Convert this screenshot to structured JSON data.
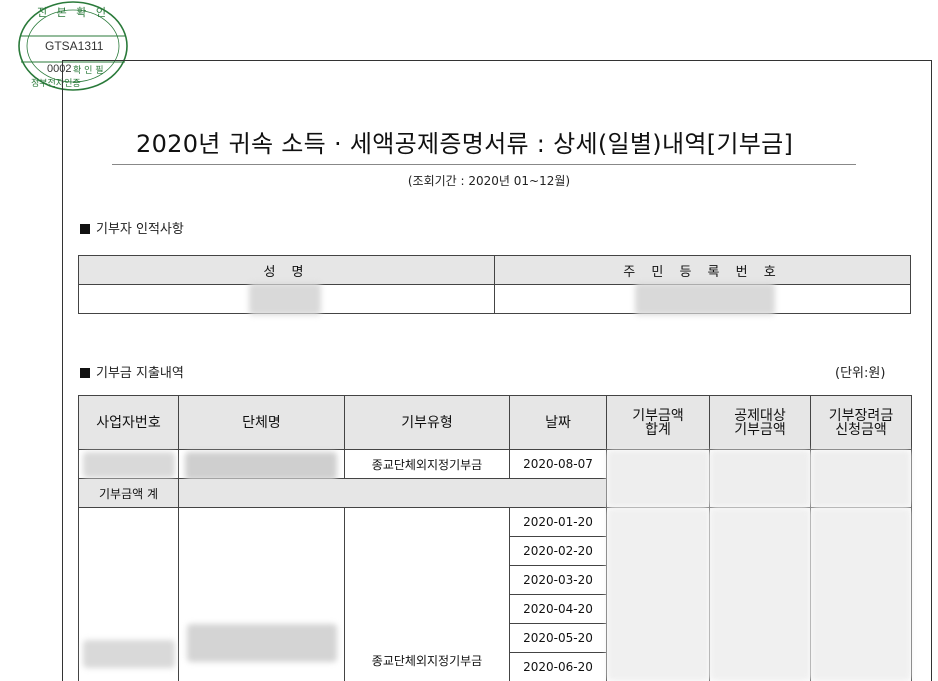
{
  "stamp": {
    "top_text": "진 본 확 인",
    "code1": "GTSA1311",
    "code2": "0002",
    "bottom_text": "정부전자인증",
    "side_text": "확 인 필"
  },
  "document": {
    "title": "2020년 귀속 소득 · 세액공제증명서류 : 상세(일별)내역[기부금]",
    "period": "(조회기간 : 2020년 01~12월)"
  },
  "donor_section": {
    "heading": "기부자 인적사항",
    "headers": [
      "성 명",
      "주 민 등 록 번 호"
    ]
  },
  "donation_section": {
    "heading": "기부금 지출내역",
    "unit": "(단위:원)",
    "headers": {
      "biz_no": "사업자번호",
      "org_name": "단체명",
      "type": "기부유형",
      "date": "날짜",
      "total": [
        "기부금액",
        "합계"
      ],
      "deductible": [
        "공제대상",
        "기부금액"
      ],
      "incentive": [
        "기부장려금",
        "신청금액"
      ]
    },
    "row1": {
      "type": "종교단체외지정기부금",
      "date": "2020-08-07"
    },
    "subtotal_label": "기부금액 계",
    "group2": {
      "type": "종교단체외지정기부금",
      "dates": [
        "2020-01-20",
        "2020-02-20",
        "2020-03-20",
        "2020-04-20",
        "2020-05-20",
        "2020-06-20"
      ]
    }
  },
  "colors": {
    "header_bg": "#e6e6e6",
    "border": "#444444",
    "stamp_green": "#2a7a3a"
  }
}
